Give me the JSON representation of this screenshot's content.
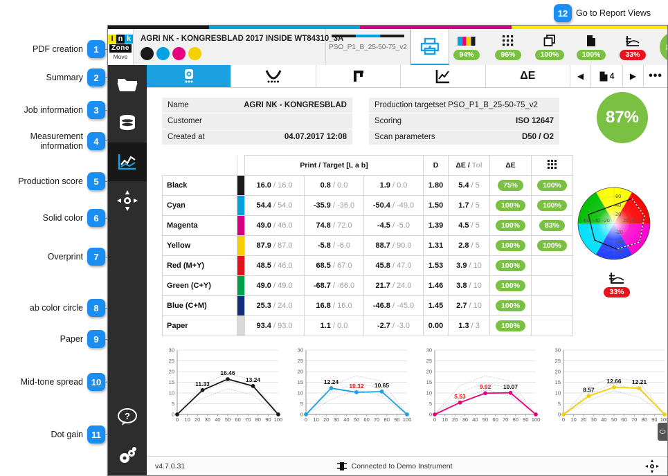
{
  "annotations": {
    "top": {
      "number": "12",
      "label": "Go to Report Views"
    },
    "items": [
      {
        "number": "1",
        "label": "PDF creation"
      },
      {
        "number": "2",
        "label": "Summary"
      },
      {
        "number": "3",
        "label": "Job information"
      },
      {
        "number": "4",
        "label": "Measurement\ninformation"
      },
      {
        "number": "5",
        "label": "Production score"
      },
      {
        "number": "6",
        "label": "Solid color"
      },
      {
        "number": "7",
        "label": "Overprint"
      },
      {
        "number": "8",
        "label": "ab color circle"
      },
      {
        "number": "9",
        "label": "Paper"
      },
      {
        "number": "10",
        "label": "Mid-tone spread"
      },
      {
        "number": "11",
        "label": "Dot gain"
      }
    ]
  },
  "header": {
    "logo": {
      "letters": [
        "I",
        "n",
        "k"
      ],
      "zone": "Zone",
      "move": "Move"
    },
    "job_title": "AGRI NK - KONGRESBLAD 2017 INSIDE WT84310_3A",
    "ink_dots": [
      "#1a1a1a",
      "#00a3e0",
      "#e6007e",
      "#f4d000"
    ],
    "targetset": "PSO_P1_B_25-50-75_v2",
    "print_icon": "printer-icon",
    "close_label": "✖",
    "metrics": [
      {
        "icon": "solid-color-icon",
        "value": "94%",
        "status": "ok"
      },
      {
        "icon": "dot-gain-grid-icon",
        "value": "96%",
        "status": "ok"
      },
      {
        "icon": "overprint-icon",
        "value": "100%",
        "status": "ok"
      },
      {
        "icon": "paper-icon",
        "value": "100%",
        "status": "ok"
      },
      {
        "icon": "midtone-spread-icon",
        "value": "33%",
        "status": "bad"
      }
    ],
    "overall_score": "87%"
  },
  "sidebar": {
    "items": [
      {
        "icon": "folder-icon",
        "name": "sidebar-item-jobs",
        "active": false
      },
      {
        "icon": "database-icon",
        "name": "sidebar-item-database",
        "active": false
      },
      {
        "icon": "chart-icon",
        "name": "sidebar-item-reports",
        "active": true
      },
      {
        "icon": "target-icon",
        "name": "sidebar-item-measurement",
        "active": false
      }
    ],
    "bottom": [
      {
        "icon": "help-icon",
        "name": "sidebar-item-help"
      },
      {
        "icon": "settings-icon",
        "name": "sidebar-item-settings"
      }
    ]
  },
  "toolbar": {
    "tabs": [
      {
        "icon": "summary-icon",
        "name": "tab-summary",
        "active": true
      },
      {
        "icon": "curve-icon",
        "name": "tab-curve",
        "active": false
      },
      {
        "icon": "register-icon",
        "name": "tab-register",
        "active": false
      },
      {
        "icon": "trend-icon",
        "name": "tab-trend",
        "active": false
      },
      {
        "icon": "delta-e-icon",
        "label": "ΔE",
        "name": "tab-delta-e",
        "active": false
      }
    ],
    "prev_label": "◀",
    "next_label": "▶",
    "page_number": "4",
    "more_label": "•••"
  },
  "job_info": {
    "rows": [
      {
        "key": "Name",
        "value": "AGRI NK - KONGRESBLAD"
      },
      {
        "key": "Customer",
        "value": ""
      },
      {
        "key": "Created at",
        "value": "04.07.2017 12:08"
      }
    ]
  },
  "measurement_info": {
    "rows": [
      {
        "key": "Production targetset PSO_P1_B_25-50-75_v2",
        "value": ""
      },
      {
        "key": "Scoring",
        "value": "ISO 12647"
      },
      {
        "key": "Scan parameters",
        "value": "D50 / O2"
      }
    ]
  },
  "production_score": "87%",
  "table": {
    "headers": {
      "blank": "",
      "print_target": "Print / Target [L a b]",
      "d": "D",
      "de_tol": "ΔE / Tol",
      "de": "ΔE",
      "dotgain": "grid-icon"
    },
    "rows": [
      {
        "name": "Black",
        "swatch": "#1a1a1a",
        "L": "16.0",
        "Lt": "16.0",
        "a": "0.8",
        "at": "0.0",
        "b": "1.9",
        "bt": "0.0",
        "d": "1.80",
        "de": "5.4",
        "tol": "5",
        "de_pct": "75%",
        "de_status": "ok",
        "dg_pct": "100%",
        "dg_status": "ok"
      },
      {
        "name": "Cyan",
        "swatch": "#00a3e0",
        "L": "54.4",
        "Lt": "54.0",
        "a": "-35.9",
        "at": "-36.0",
        "b": "-50.4",
        "bt": "-49.0",
        "d": "1.50",
        "de": "1.7",
        "tol": "5",
        "de_pct": "100%",
        "de_status": "ok",
        "dg_pct": "100%",
        "dg_status": "ok"
      },
      {
        "name": "Magenta",
        "swatch": "#d6007f",
        "L": "49.0",
        "Lt": "46.0",
        "a": "74.8",
        "at": "72.0",
        "b": "-4.5",
        "bt": "-5.0",
        "d": "1.39",
        "de": "4.5",
        "tol": "5",
        "de_pct": "100%",
        "de_status": "ok",
        "dg_pct": "83%",
        "dg_status": "ok"
      },
      {
        "name": "Yellow",
        "swatch": "#f4d000",
        "L": "87.9",
        "Lt": "87.0",
        "a": "-5.8",
        "at": "-6.0",
        "b": "88.7",
        "bt": "90.0",
        "d": "1.31",
        "de": "2.8",
        "tol": "5",
        "de_pct": "100%",
        "de_status": "ok",
        "dg_pct": "100%",
        "dg_status": "ok"
      },
      {
        "name": "Red (M+Y)",
        "swatch": "#e1121c",
        "L": "48.5",
        "Lt": "46.0",
        "a": "68.5",
        "at": "67.0",
        "b": "45.8",
        "bt": "47.0",
        "d": "1.53",
        "de": "3.9",
        "tol": "10",
        "de_pct": "100%",
        "de_status": "ok",
        "dg_pct": "",
        "dg_status": ""
      },
      {
        "name": "Green (C+Y)",
        "swatch": "#00a04a",
        "L": "49.0",
        "Lt": "49.0",
        "a": "-68.7",
        "at": "-66.0",
        "b": "21.7",
        "bt": "24.0",
        "d": "1.46",
        "de": "3.8",
        "tol": "10",
        "de_pct": "100%",
        "de_status": "ok",
        "dg_pct": "",
        "dg_status": ""
      },
      {
        "name": "Blue (C+M)",
        "swatch": "#122b7a",
        "L": "25.3",
        "Lt": "24.0",
        "a": "16.8",
        "at": "16.0",
        "b": "-46.8",
        "bt": "-45.0",
        "d": "1.45",
        "de": "2.7",
        "tol": "10",
        "de_pct": "100%",
        "de_status": "ok",
        "dg_pct": "",
        "dg_status": ""
      },
      {
        "name": "Paper",
        "swatch": "#d9d9d9",
        "L": "93.4",
        "Lt": "93.0",
        "a": "1.1",
        "at": "0.0",
        "b": "-2.7",
        "bt": "-3.0",
        "d": "0.00",
        "de": "1.3",
        "tol": "3",
        "de_pct": "100%",
        "de_status": "ok",
        "dg_pct": "",
        "dg_status": ""
      }
    ]
  },
  "midtone": {
    "icon": "midtone-spread-icon",
    "value": "33%",
    "status": "bad"
  },
  "ab_circle": {
    "name": "ab-color-circle"
  },
  "chart_data": [
    {
      "type": "line",
      "name": "Dot gain Black",
      "color": "#1a1a1a",
      "x": [
        0,
        25,
        50,
        75,
        100
      ],
      "values": [
        0,
        11.33,
        16.46,
        13.24,
        0
      ],
      "labels": [
        "",
        "11.33",
        "16.46",
        "13.24",
        ""
      ],
      "label_status": [
        "",
        "ok",
        "ok",
        "ok",
        ""
      ],
      "xticks": [
        0,
        10,
        20,
        30,
        40,
        50,
        60,
        70,
        80,
        90,
        100
      ],
      "yticks": [
        0,
        5,
        10,
        15,
        20,
        25,
        30
      ],
      "ylim": [
        0,
        30
      ],
      "xlim": [
        0,
        100
      ],
      "tol_upper": [
        0,
        14.0,
        19.0,
        16.0,
        0
      ],
      "tol_lower": [
        0,
        7.5,
        12.0,
        9.0,
        0
      ],
      "grid": true
    },
    {
      "type": "line",
      "name": "Dot gain Cyan",
      "color": "#1ba1e2",
      "x": [
        0,
        25,
        50,
        75,
        100
      ],
      "values": [
        0,
        12.24,
        10.32,
        10.65,
        0
      ],
      "labels": [
        "",
        "12.24",
        "10.32",
        "10.65",
        ""
      ],
      "label_status": [
        "",
        "ok",
        "bad",
        "ok",
        ""
      ],
      "xticks": [
        0,
        10,
        20,
        30,
        40,
        50,
        60,
        70,
        80,
        90,
        100
      ],
      "yticks": [
        0,
        5,
        10,
        15,
        20,
        25,
        30
      ],
      "ylim": [
        0,
        30
      ],
      "xlim": [
        0,
        100
      ],
      "tol_upper": [
        0,
        13.5,
        18.0,
        15.5,
        0
      ],
      "tol_lower": [
        0,
        7.0,
        11.5,
        8.5,
        0
      ],
      "grid": true
    },
    {
      "type": "line",
      "name": "Dot gain Magenta",
      "color": "#e6007e",
      "x": [
        0,
        25,
        50,
        75,
        100
      ],
      "values": [
        0,
        5.53,
        9.92,
        10.07,
        0
      ],
      "labels": [
        "",
        "5.53",
        "9.92",
        "10.07",
        ""
      ],
      "label_status": [
        "",
        "bad",
        "bad",
        "ok",
        ""
      ],
      "xticks": [
        0,
        10,
        20,
        30,
        40,
        50,
        60,
        70,
        80,
        90,
        100
      ],
      "yticks": [
        0,
        5,
        10,
        15,
        20,
        25,
        30
      ],
      "ylim": [
        0,
        30
      ],
      "xlim": [
        0,
        100
      ],
      "tol_upper": [
        0,
        13.5,
        18.0,
        15.5,
        0
      ],
      "tol_lower": [
        0,
        7.0,
        11.5,
        8.5,
        0
      ],
      "grid": true
    },
    {
      "type": "line",
      "name": "Dot gain Yellow",
      "color": "#f4d000",
      "x": [
        0,
        25,
        50,
        75,
        100
      ],
      "values": [
        0,
        8.57,
        12.66,
        12.21,
        0
      ],
      "labels": [
        "",
        "8.57",
        "12.66",
        "12.21",
        ""
      ],
      "label_status": [
        "",
        "ok",
        "ok",
        "ok",
        ""
      ],
      "xticks": [
        0,
        10,
        20,
        30,
        40,
        50,
        60,
        70,
        80,
        90,
        100
      ],
      "yticks": [
        0,
        5,
        10,
        15,
        20,
        25,
        30
      ],
      "ylim": [
        0,
        30
      ],
      "xlim": [
        0,
        100
      ],
      "tol_upper": [
        0,
        13.0,
        17.5,
        15.0,
        0
      ],
      "tol_lower": [
        0,
        6.5,
        11.0,
        8.0,
        0
      ],
      "grid": true
    }
  ],
  "statusbar": {
    "version": "v4.7.0.31",
    "connection": "Connected to Demo Instrument",
    "instrument_icon": "device-icon",
    "target_icon": "target-icon"
  },
  "colors": {
    "accent": "#1ba1e2",
    "ok": "#7ac143",
    "bad": "#e8131c",
    "callout": "#1b8ef2"
  }
}
